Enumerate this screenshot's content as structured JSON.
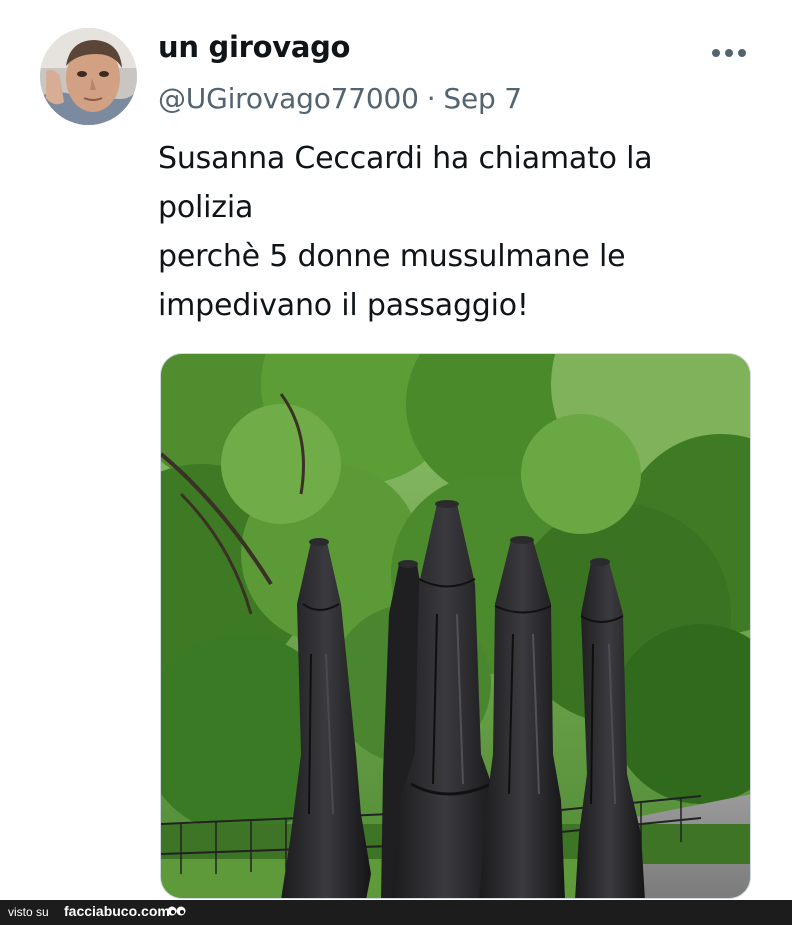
{
  "tweet": {
    "display_name": "un girovago",
    "handle": "@UGirovago77000",
    "separator": "·",
    "date": "Sep 7",
    "text_lines": [
      "Susanna Ceccardi ha chiamato la",
      "polizia",
      "perchè 5 donne mussulmane le",
      "impedivano il passaggio!"
    ],
    "more_icon": "ellipsis-icon",
    "media": {
      "subject": "five closed black patio umbrellas in front of green trees in a park"
    }
  },
  "footer": {
    "visto_label": "visto su",
    "brand": "facciabuco.com",
    "brand_icon": "eyes-icon"
  },
  "colors": {
    "text_primary": "#0f1419",
    "text_secondary": "#536471",
    "footer_bg": "#1c1c1c"
  }
}
